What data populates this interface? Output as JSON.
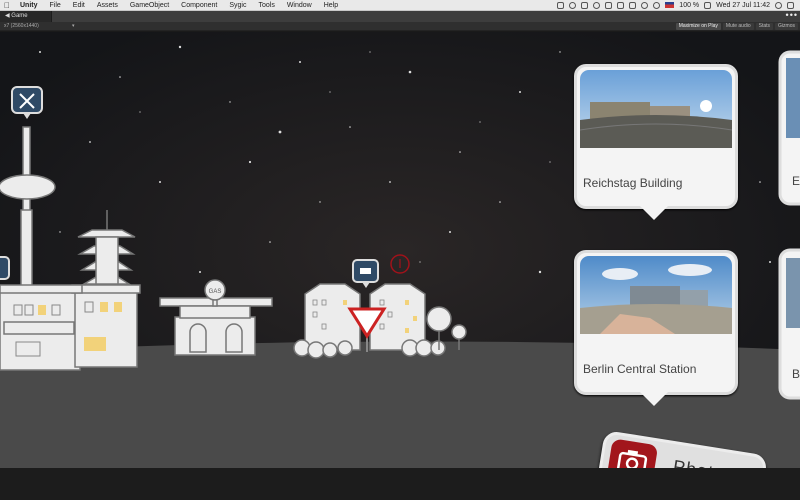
{
  "menubar": {
    "app": "Unity",
    "items": [
      "File",
      "Edit",
      "Assets",
      "GameObject",
      "Component",
      "Sygic",
      "Tools",
      "Window",
      "Help"
    ],
    "battery": "100 %",
    "datetime": "Wed 27 Jul  11:42"
  },
  "tabbar": {
    "tab_label": "Game"
  },
  "toolbar": {
    "resolution": "x7 (2560x1440)",
    "buttons": [
      {
        "label": "Maximize on Play",
        "active": true
      },
      {
        "label": "Mute audio",
        "active": false
      },
      {
        "label": "Stats",
        "active": false
      },
      {
        "label": "Gizmos",
        "active": false
      }
    ]
  },
  "scene": {
    "cards": [
      {
        "caption": "Reichstag Building"
      },
      {
        "caption": "Berlin Central Station"
      }
    ],
    "partial_cards": [
      "E",
      "B"
    ],
    "photos_button": {
      "label": "Photos"
    }
  },
  "colors": {
    "accent_red": "#a2161c",
    "ground": "#4a4a4a",
    "card_bg": "#f4f4f4"
  }
}
